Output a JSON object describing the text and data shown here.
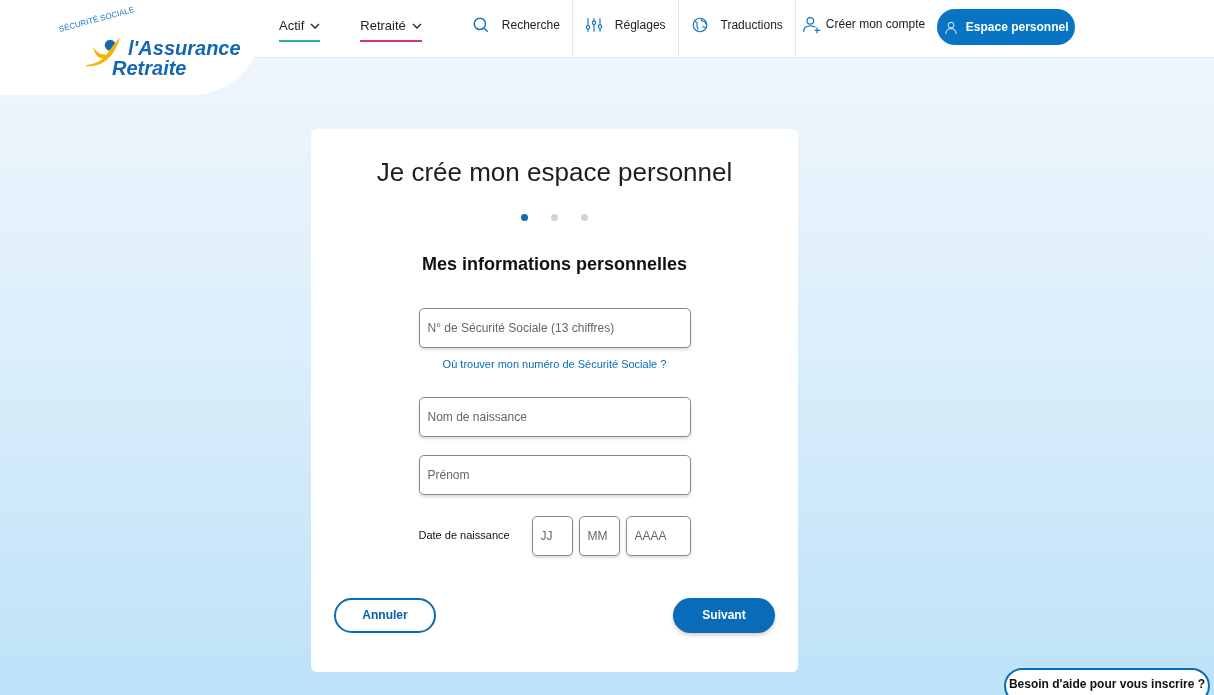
{
  "logo": {
    "arc_text": "SÉCURITÉ SOCIALE",
    "line1": "l'Assurance",
    "line2": "Retraite"
  },
  "nav": {
    "menus": [
      {
        "label": "Actif",
        "color": "#2bb39a"
      },
      {
        "label": "Retraité",
        "color": "#d4365c"
      }
    ],
    "tools": [
      {
        "kind": "search",
        "label": "Recherche"
      },
      {
        "kind": "settings",
        "label": "Réglages"
      },
      {
        "kind": "globe",
        "label": "Traductions"
      }
    ],
    "create_account": "Créer mon compte",
    "personal_space": "Espace personnel"
  },
  "card": {
    "title": "Je crée mon espace personnel",
    "steps": [
      {
        "selected": true
      },
      {
        "selected": false
      },
      {
        "selected": false
      }
    ],
    "section_title": "Mes informations personnelles",
    "ssn_field": {
      "placeholder": "N° de Sécurité Sociale (13 chiffres)"
    },
    "ssn_help_link": "Où trouver mon numéro de Sécurité Sociale ?",
    "last_name_field": {
      "placeholder": "Nom de naissance"
    },
    "first_name_field": {
      "placeholder": "Prénom"
    },
    "birth_date": {
      "label": "Date de naissance",
      "fields": [
        {
          "placeholder": "JJ"
        },
        {
          "placeholder": "MM"
        },
        {
          "placeholder": "AAAA"
        }
      ]
    },
    "cancel_button": "Annuler",
    "next_button": "Suivant"
  },
  "help_button": "Besoin d'aide pour vous inscrire ?"
}
